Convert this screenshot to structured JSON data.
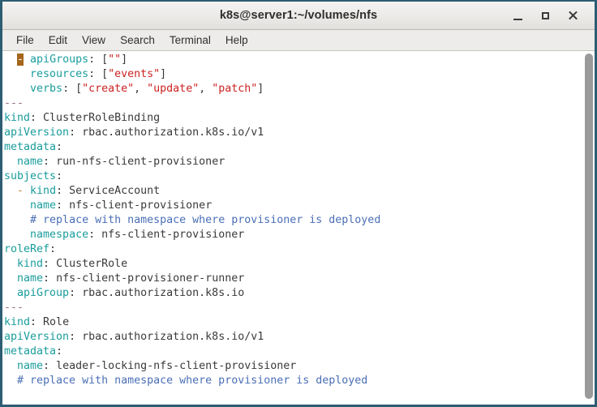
{
  "window": {
    "title": "k8s@server1:~/volumes/nfs",
    "controls": {
      "minimize": "minimize-button",
      "maximize": "maximize-button",
      "close": "close-button"
    },
    "border_color": "#2d5d73",
    "titlebar_color": "#eceae8"
  },
  "menubar": {
    "items": [
      {
        "label": "File"
      },
      {
        "label": "Edit"
      },
      {
        "label": "View"
      },
      {
        "label": "Search"
      },
      {
        "label": "Terminal"
      },
      {
        "label": "Help"
      }
    ]
  },
  "terminal": {
    "background": "#ffffff",
    "foreground": "#3a3a3a",
    "cursor": {
      "char": "-",
      "background": "#a5661c",
      "foreground": "#ffffff",
      "line": 1,
      "column": 3
    },
    "colors": {
      "key": "#1a9c9c",
      "string": "#cc2222",
      "comment": "#4a6fb5",
      "separator": "#9a6a8a",
      "dash": "#c08a3e",
      "value": "#3a3a3a"
    },
    "lines": [
      "  - apiGroups: [\"\"]",
      "    resources: [\"events\"]",
      "    verbs: [\"create\", \"update\", \"patch\"]",
      "---",
      "kind: ClusterRoleBinding",
      "apiVersion: rbac.authorization.k8s.io/v1",
      "metadata:",
      "  name: run-nfs-client-provisioner",
      "subjects:",
      "  - kind: ServiceAccount",
      "    name: nfs-client-provisioner",
      "    # replace with namespace where provisioner is deployed",
      "    namespace: nfs-client-provisioner",
      "roleRef:",
      "  kind: ClusterRole",
      "  name: nfs-client-provisioner-runner",
      "  apiGroup: rbac.authorization.k8s.io",
      "---",
      "kind: Role",
      "apiVersion: rbac.authorization.k8s.io/v1",
      "metadata:",
      "  name: leader-locking-nfs-client-provisioner",
      "  # replace with namespace where provisioner is deployed"
    ],
    "tokens": [
      {
        "segments": [
          {
            "t": "  ",
            "c": "p"
          },
          {
            "t": "-",
            "c": "cursor"
          },
          {
            "t": " ",
            "c": "p"
          },
          {
            "t": "apiGroups",
            "c": "k"
          },
          {
            "t": ": ",
            "c": "p"
          },
          {
            "t": "[",
            "c": "p"
          },
          {
            "t": "\"\"",
            "c": "s"
          },
          {
            "t": "]",
            "c": "p"
          }
        ]
      },
      {
        "segments": [
          {
            "t": "    ",
            "c": "p"
          },
          {
            "t": "resources",
            "c": "k"
          },
          {
            "t": ": ",
            "c": "p"
          },
          {
            "t": "[",
            "c": "p"
          },
          {
            "t": "\"events\"",
            "c": "s"
          },
          {
            "t": "]",
            "c": "p"
          }
        ]
      },
      {
        "segments": [
          {
            "t": "    ",
            "c": "p"
          },
          {
            "t": "verbs",
            "c": "k"
          },
          {
            "t": ": ",
            "c": "p"
          },
          {
            "t": "[",
            "c": "p"
          },
          {
            "t": "\"create\"",
            "c": "s"
          },
          {
            "t": ", ",
            "c": "p"
          },
          {
            "t": "\"update\"",
            "c": "s"
          },
          {
            "t": ", ",
            "c": "p"
          },
          {
            "t": "\"patch\"",
            "c": "s"
          },
          {
            "t": "]",
            "c": "p"
          }
        ]
      },
      {
        "segments": [
          {
            "t": "---",
            "c": "d"
          }
        ]
      },
      {
        "segments": [
          {
            "t": "kind",
            "c": "k"
          },
          {
            "t": ": ",
            "c": "p"
          },
          {
            "t": "ClusterRoleBinding",
            "c": "v"
          }
        ]
      },
      {
        "segments": [
          {
            "t": "apiVersion",
            "c": "k"
          },
          {
            "t": ": ",
            "c": "p"
          },
          {
            "t": "rbac.authorization.k8s.io/v1",
            "c": "v"
          }
        ]
      },
      {
        "segments": [
          {
            "t": "metadata",
            "c": "k"
          },
          {
            "t": ":",
            "c": "p"
          }
        ]
      },
      {
        "segments": [
          {
            "t": "  ",
            "c": "p"
          },
          {
            "t": "name",
            "c": "k"
          },
          {
            "t": ": ",
            "c": "p"
          },
          {
            "t": "run-nfs-client-provisioner",
            "c": "v"
          }
        ]
      },
      {
        "segments": [
          {
            "t": "subjects",
            "c": "k"
          },
          {
            "t": ":",
            "c": "p"
          }
        ]
      },
      {
        "segments": [
          {
            "t": "  ",
            "c": "p"
          },
          {
            "t": "-",
            "c": "dash"
          },
          {
            "t": " ",
            "c": "p"
          },
          {
            "t": "kind",
            "c": "k"
          },
          {
            "t": ": ",
            "c": "p"
          },
          {
            "t": "ServiceAccount",
            "c": "v"
          }
        ]
      },
      {
        "segments": [
          {
            "t": "    ",
            "c": "p"
          },
          {
            "t": "name",
            "c": "k"
          },
          {
            "t": ": ",
            "c": "p"
          },
          {
            "t": "nfs-client-provisioner",
            "c": "v"
          }
        ]
      },
      {
        "segments": [
          {
            "t": "    ",
            "c": "p"
          },
          {
            "t": "# replace with namespace where provisioner is deployed",
            "c": "c"
          }
        ]
      },
      {
        "segments": [
          {
            "t": "    ",
            "c": "p"
          },
          {
            "t": "namespace",
            "c": "k"
          },
          {
            "t": ": ",
            "c": "p"
          },
          {
            "t": "nfs-client-provisioner",
            "c": "v"
          }
        ]
      },
      {
        "segments": [
          {
            "t": "roleRef",
            "c": "k"
          },
          {
            "t": ":",
            "c": "p"
          }
        ]
      },
      {
        "segments": [
          {
            "t": "  ",
            "c": "p"
          },
          {
            "t": "kind",
            "c": "k"
          },
          {
            "t": ": ",
            "c": "p"
          },
          {
            "t": "ClusterRole",
            "c": "v"
          }
        ]
      },
      {
        "segments": [
          {
            "t": "  ",
            "c": "p"
          },
          {
            "t": "name",
            "c": "k"
          },
          {
            "t": ": ",
            "c": "p"
          },
          {
            "t": "nfs-client-provisioner-runner",
            "c": "v"
          }
        ]
      },
      {
        "segments": [
          {
            "t": "  ",
            "c": "p"
          },
          {
            "t": "apiGroup",
            "c": "k"
          },
          {
            "t": ": ",
            "c": "p"
          },
          {
            "t": "rbac.authorization.k8s.io",
            "c": "v"
          }
        ]
      },
      {
        "segments": [
          {
            "t": "---",
            "c": "d"
          }
        ]
      },
      {
        "segments": [
          {
            "t": "kind",
            "c": "k"
          },
          {
            "t": ": ",
            "c": "p"
          },
          {
            "t": "Role",
            "c": "v"
          }
        ]
      },
      {
        "segments": [
          {
            "t": "apiVersion",
            "c": "k"
          },
          {
            "t": ": ",
            "c": "p"
          },
          {
            "t": "rbac.authorization.k8s.io/v1",
            "c": "v"
          }
        ]
      },
      {
        "segments": [
          {
            "t": "metadata",
            "c": "k"
          },
          {
            "t": ":",
            "c": "p"
          }
        ]
      },
      {
        "segments": [
          {
            "t": "  ",
            "c": "p"
          },
          {
            "t": "name",
            "c": "k"
          },
          {
            "t": ": ",
            "c": "p"
          },
          {
            "t": "leader-locking-nfs-client-provisioner",
            "c": "v"
          }
        ]
      },
      {
        "segments": [
          {
            "t": "  ",
            "c": "p"
          },
          {
            "t": "# replace with namespace where provisioner is deployed",
            "c": "c"
          }
        ]
      }
    ]
  },
  "scrollbar": {
    "thumb_color": "#9a9a9a",
    "track_color": "#ffffff"
  }
}
